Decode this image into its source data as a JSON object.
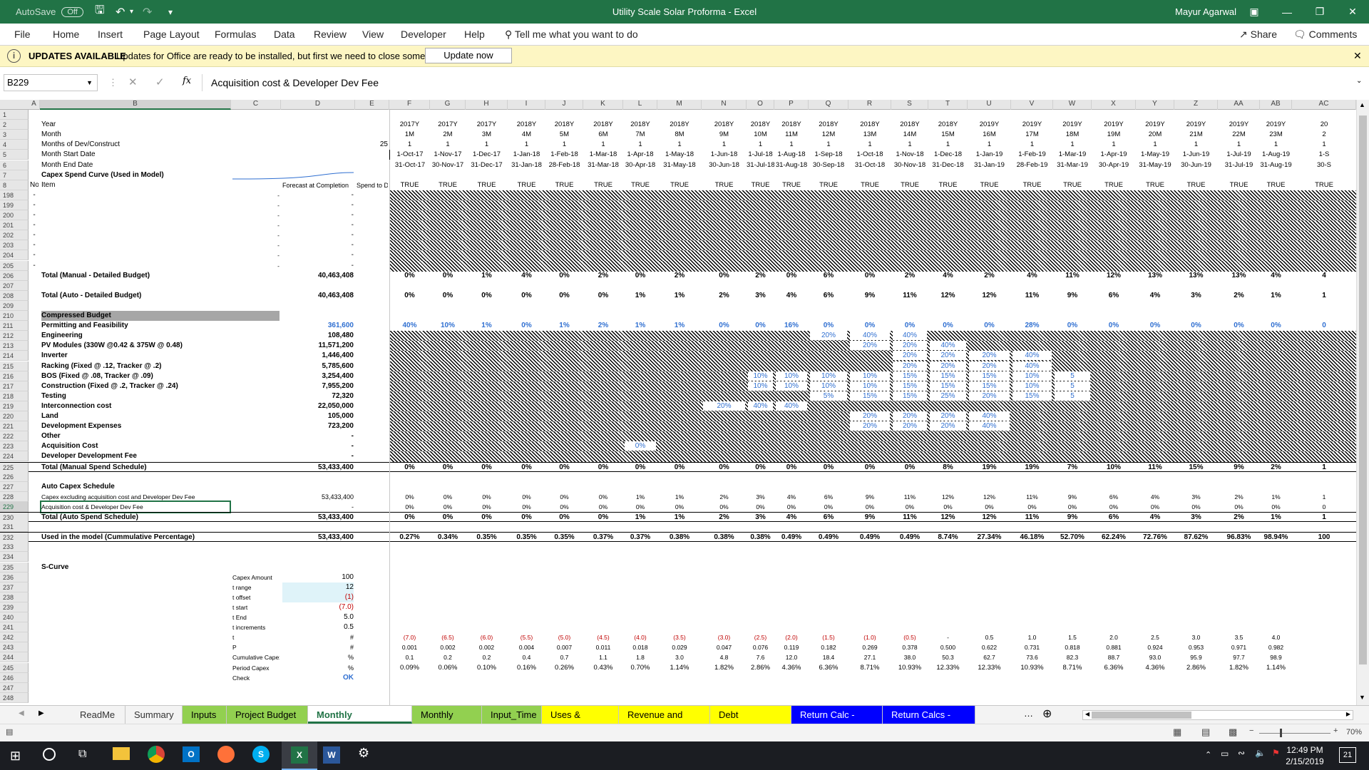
{
  "title": "Utility Scale Solar Proforma  -  Excel",
  "autosave_label": "AutoSave",
  "autosave_state": "Off",
  "user": "Mayur Agarwal",
  "ribbon_tabs": [
    "File",
    "Home",
    "Insert",
    "Page Layout",
    "Formulas",
    "Data",
    "Review",
    "View",
    "Developer",
    "Help"
  ],
  "tell_me": "Tell me what you want to do",
  "share": "Share",
  "comments": "Comments",
  "update_title": "UPDATES AVAILABLE",
  "update_msg": "Updates for Office are ready to be installed, but first we need to close some apps.",
  "update_btn": "Update now",
  "namebox": "B229",
  "formula": "Acquisition cost & Developer Dev Fee",
  "col_headers": [
    "A",
    "B",
    "C",
    "D",
    "E",
    "F",
    "G",
    "H",
    "I",
    "J",
    "K",
    "L",
    "M",
    "N",
    "O",
    "P",
    "Q",
    "R",
    "S",
    "T",
    "U",
    "V",
    "W",
    "X",
    "Y",
    "Z",
    "AA",
    "AB",
    "AC"
  ],
  "years": [
    "2017Y",
    "2017Y",
    "2017Y",
    "2018Y",
    "2018Y",
    "2018Y",
    "2018Y",
    "2018Y",
    "2018Y",
    "2018Y",
    "2018Y",
    "2018Y",
    "2018Y",
    "2018Y",
    "2018Y",
    "2019Y",
    "2019Y",
    "2019Y",
    "2019Y",
    "2019Y",
    "2019Y",
    "2019Y",
    "2019Y",
    "20"
  ],
  "months": [
    "1M",
    "2M",
    "3M",
    "4M",
    "5M",
    "6M",
    "7M",
    "8M",
    "9M",
    "10M",
    "11M",
    "12M",
    "13M",
    "14M",
    "15M",
    "16M",
    "17M",
    "18M",
    "19M",
    "20M",
    "21M",
    "22M",
    "23M",
    "2"
  ],
  "starts": [
    "1-Oct-17",
    "1-Nov-17",
    "1-Dec-17",
    "1-Jan-18",
    "1-Feb-18",
    "1-Mar-18",
    "1-Apr-18",
    "1-May-18",
    "1-Jun-18",
    "1-Jul-18",
    "1-Aug-18",
    "1-Sep-18",
    "1-Oct-18",
    "1-Nov-18",
    "1-Dec-18",
    "1-Jan-19",
    "1-Feb-19",
    "1-Mar-19",
    "1-Apr-19",
    "1-May-19",
    "1-Jun-19",
    "1-Jul-19",
    "1-Aug-19",
    "1-S"
  ],
  "ends": [
    "31-Oct-17",
    "30-Nov-17",
    "31-Dec-17",
    "31-Jan-18",
    "28-Feb-18",
    "31-Mar-18",
    "30-Apr-18",
    "31-May-18",
    "30-Jun-18",
    "31-Jul-18",
    "31-Aug-18",
    "30-Sep-18",
    "31-Oct-18",
    "30-Nov-18",
    "31-Dec-18",
    "31-Jan-19",
    "28-Feb-19",
    "31-Mar-19",
    "30-Apr-19",
    "31-May-19",
    "30-Jun-19",
    "31-Jul-19",
    "31-Aug-19",
    "30-S"
  ],
  "rows": [
    {
      "n": "1"
    },
    {
      "n": "2",
      "b": "Year",
      "timeline": "years"
    },
    {
      "n": "3",
      "b": "Month",
      "timeline": "months"
    },
    {
      "n": "4",
      "b": "Months of Dev/Construct",
      "e": "25",
      "timeline": "ones"
    },
    {
      "n": "5",
      "b": "Month Start Date",
      "timeline": "starts"
    },
    {
      "n": "6",
      "b": "Month End Date",
      "timeline": "ends"
    },
    {
      "n": "7",
      "b": "Capex Spend Curve (Used in Model)",
      "bold": true
    },
    {
      "n": "8",
      "a": "No.",
      "b": "Item",
      "d": "Forecast at Completion",
      "e": "Spend to Date",
      "timeline": "trues"
    },
    {
      "n": "198",
      "a": "-",
      "c": "-",
      "d": "-",
      "hatch": true
    },
    {
      "n": "199",
      "a": "-",
      "c": "-",
      "d": "-",
      "hatch": true
    },
    {
      "n": "200",
      "a": "-",
      "c": "-",
      "d": "-",
      "hatch": true
    },
    {
      "n": "201",
      "a": "-",
      "c": "-",
      "d": "-",
      "hatch": true
    },
    {
      "n": "202",
      "a": "-",
      "c": "-",
      "d": "-",
      "hatch": true
    },
    {
      "n": "203",
      "a": "-",
      "c": "-",
      "d": "-",
      "hatch": true
    },
    {
      "n": "204",
      "a": "-",
      "c": "-",
      "d": "-",
      "hatch": true
    },
    {
      "n": "205",
      "a": "-",
      "c": "-",
      "d": "-",
      "hatch": true
    },
    {
      "n": "206",
      "b": "Total (Manual - Detailed Budget)",
      "d": "40,463,408",
      "bold": true,
      "vals": [
        "0%",
        "0%",
        "1%",
        "4%",
        "0%",
        "2%",
        "0%",
        "2%",
        "0%",
        "2%",
        "0%",
        "6%",
        "0%",
        "2%",
        "4%",
        "2%",
        "4%",
        "11%",
        "12%",
        "13%",
        "13%",
        "13%",
        "4%",
        "4"
      ]
    },
    {
      "n": "207"
    },
    {
      "n": "208",
      "b": "Total (Auto - Detailed Budget)",
      "d": "40,463,408",
      "bold": true,
      "vals": [
        "0%",
        "0%",
        "0%",
        "0%",
        "0%",
        "0%",
        "1%",
        "1%",
        "2%",
        "3%",
        "4%",
        "6%",
        "9%",
        "11%",
        "12%",
        "12%",
        "11%",
        "9%",
        "6%",
        "4%",
        "3%",
        "2%",
        "1%",
        "1"
      ]
    },
    {
      "n": "209"
    },
    {
      "n": "210",
      "b": "Compressed Budget",
      "bold": true,
      "grey": true
    },
    {
      "n": "211",
      "b": "Permitting and Feasibility",
      "d": "361,600",
      "bold": true,
      "blue": true,
      "vals": [
        "40%",
        "10%",
        "1%",
        "0%",
        "1%",
        "2%",
        "1%",
        "1%",
        "0%",
        "0%",
        "16%",
        "0%",
        "0%",
        "0%",
        "0%",
        "0%",
        "28%",
        "0%",
        "0%",
        "0%",
        "0%",
        "0%",
        "0%",
        "0"
      ]
    },
    {
      "n": "212",
      "b": "Engineering",
      "d": "108,480",
      "bold": true,
      "hatch": true
    },
    {
      "n": "213",
      "b": "PV Modules (330W @0.42 & 375W @ 0.48)",
      "d": "11,571,200",
      "bold": true,
      "hatch": true
    },
    {
      "n": "214",
      "b": "Inverter",
      "d": "1,446,400",
      "bold": true,
      "hatch": true
    },
    {
      "n": "215",
      "b": "Racking (Fixed @ .12, Tracker @ .2)",
      "d": "5,785,600",
      "bold": true,
      "hatch": true
    },
    {
      "n": "216",
      "b": "BOS (Fixed @ .08, Tracker @ .09)",
      "d": "3,254,400",
      "bold": true,
      "hatch": true
    },
    {
      "n": "217",
      "b": "Construction (Fixed @ .2, Tracker @ .24)",
      "d": "7,955,200",
      "bold": true,
      "hatch": true
    },
    {
      "n": "218",
      "b": "Testing",
      "d": "72,320",
      "bold": true,
      "hatch": true
    },
    {
      "n": "219",
      "b": "Interconnection cost",
      "d": "22,050,000",
      "bold": true,
      "hatch": true
    },
    {
      "n": "220",
      "b": "Land",
      "d": "105,000",
      "bold": true,
      "hatch": true
    },
    {
      "n": "221",
      "b": "Development Expenses",
      "d": "723,200",
      "bold": true,
      "hatch": true
    },
    {
      "n": "222",
      "b": "Other",
      "d": "-",
      "bold": true,
      "hatch": true
    },
    {
      "n": "223",
      "b": "Acquisition Cost",
      "d": "-",
      "bold": true,
      "hatch": true
    },
    {
      "n": "224",
      "b": "Developer  Development Fee",
      "d": "-",
      "bold": true,
      "hatch": true
    },
    {
      "n": "225",
      "b": "Total (Manual Spend Schedule)",
      "d": "53,433,400",
      "bold": true,
      "boxed": true,
      "vals": [
        "0%",
        "0%",
        "0%",
        "0%",
        "0%",
        "0%",
        "0%",
        "0%",
        "0%",
        "0%",
        "0%",
        "0%",
        "0%",
        "0%",
        "8%",
        "19%",
        "19%",
        "7%",
        "10%",
        "11%",
        "15%",
        "9%",
        "2%",
        "1"
      ]
    },
    {
      "n": "226"
    },
    {
      "n": "227",
      "b": "Auto Capex Schedule",
      "bold": true
    },
    {
      "n": "228",
      "b": "Capex excluding acquisition cost and Developer Dev Fee",
      "d": "53,433,400",
      "small": true,
      "vals": [
        "0%",
        "0%",
        "0%",
        "0%",
        "0%",
        "0%",
        "1%",
        "1%",
        "2%",
        "3%",
        "4%",
        "6%",
        "9%",
        "11%",
        "12%",
        "12%",
        "11%",
        "9%",
        "6%",
        "4%",
        "3%",
        "2%",
        "1%",
        "1"
      ]
    },
    {
      "n": "229",
      "b": "Acquisition cost & Developer Dev Fee",
      "d": "-",
      "small": true,
      "selected": true,
      "vals": [
        "0%",
        "0%",
        "0%",
        "0%",
        "0%",
        "0%",
        "0%",
        "0%",
        "0%",
        "0%",
        "0%",
        "0%",
        "0%",
        "0%",
        "0%",
        "0%",
        "0%",
        "0%",
        "0%",
        "0%",
        "0%",
        "0%",
        "0%",
        "0"
      ]
    },
    {
      "n": "230",
      "b": "Total (Auto Spend Schedule)",
      "d": "53,433,400",
      "bold": true,
      "boxed": true,
      "vals": [
        "0%",
        "0%",
        "0%",
        "0%",
        "0%",
        "0%",
        "1%",
        "1%",
        "2%",
        "3%",
        "4%",
        "6%",
        "9%",
        "11%",
        "12%",
        "12%",
        "11%",
        "9%",
        "6%",
        "4%",
        "3%",
        "2%",
        "1%",
        "1"
      ]
    },
    {
      "n": "231"
    },
    {
      "n": "232",
      "b": "Used in the model (Cummulative Percentage)",
      "d": "53,433,400",
      "bold": true,
      "boxed": true,
      "vals": [
        "0.27%",
        "0.34%",
        "0.35%",
        "0.35%",
        "0.35%",
        "0.37%",
        "0.37%",
        "0.38%",
        "0.38%",
        "0.38%",
        "0.49%",
        "0.49%",
        "0.49%",
        "0.49%",
        "8.74%",
        "27.34%",
        "46.18%",
        "52.70%",
        "62.24%",
        "72.76%",
        "87.62%",
        "96.83%",
        "98.94%",
        "100"
      ]
    },
    {
      "n": "233"
    },
    {
      "n": "234"
    },
    {
      "n": "235",
      "b": "S-Curve",
      "bold": true
    },
    {
      "n": "236",
      "c": "Capex Amount",
      "d": "100"
    },
    {
      "n": "237",
      "c": "t range",
      "d": "12",
      "cyan": true
    },
    {
      "n": "238",
      "c": "t offset",
      "d": "(1)",
      "cyan": true,
      "red": true
    },
    {
      "n": "239",
      "c": "t start",
      "d": "(7.0)",
      "red": true
    },
    {
      "n": "240",
      "c": "t End",
      "d": "5.0"
    },
    {
      "n": "241",
      "c": "t increments",
      "d": "0.5"
    },
    {
      "n": "242",
      "c": "t",
      "d": "#",
      "vals": [
        "(7.0)",
        "(6.5)",
        "(6.0)",
        "(5.5)",
        "(5.0)",
        "(4.5)",
        "(4.0)",
        "(3.5)",
        "(3.0)",
        "(2.5)",
        "(2.0)",
        "(1.5)",
        "(1.0)",
        "(0.5)",
        "-",
        "0.5",
        "1.0",
        "1.5",
        "2.0",
        "2.5",
        "3.0",
        "3.5",
        "4.0",
        ""
      ],
      "small": true
    },
    {
      "n": "243",
      "c": "P",
      "d": "#",
      "vals": [
        "0.001",
        "0.002",
        "0.002",
        "0.004",
        "0.007",
        "0.011",
        "0.018",
        "0.029",
        "0.047",
        "0.076",
        "0.119",
        "0.182",
        "0.269",
        "0.378",
        "0.500",
        "0.622",
        "0.731",
        "0.818",
        "0.881",
        "0.924",
        "0.953",
        "0.971",
        "0.982",
        ""
      ],
      "small": true
    },
    {
      "n": "244",
      "c": "Cumulative Capex",
      "d": "%",
      "vals": [
        "0.1",
        "0.2",
        "0.2",
        "0.4",
        "0.7",
        "1.1",
        "1.8",
        "3.0",
        "4.8",
        "7.6",
        "12.0",
        "18.4",
        "27.1",
        "38.0",
        "50.3",
        "62.7",
        "73.6",
        "82.3",
        "88.7",
        "93.0",
        "95.9",
        "97.7",
        "98.9",
        ""
      ],
      "small": true
    },
    {
      "n": "245",
      "c": "Period Capex",
      "d": "%",
      "vals": [
        "0.09%",
        "0.06%",
        "0.10%",
        "0.16%",
        "0.26%",
        "0.43%",
        "0.70%",
        "1.14%",
        "1.82%",
        "2.86%",
        "4.36%",
        "6.36%",
        "8.71%",
        "10.93%",
        "12.33%",
        "12.33%",
        "10.93%",
        "8.71%",
        "6.36%",
        "4.36%",
        "2.86%",
        "1.82%",
        "1.14%",
        ""
      ],
      "small": true
    },
    {
      "n": "246",
      "c": "Check",
      "d": "OK",
      "blue": true
    },
    {
      "n": "247"
    },
    {
      "n": "248"
    }
  ],
  "sheet_tabs": [
    {
      "label": "ReadMe",
      "color": "#f3f3f3",
      "fg": "#333"
    },
    {
      "label": "Summary",
      "color": "#f3f3f3",
      "fg": "#333"
    },
    {
      "label": "Inputs",
      "color": "#92d050",
      "fg": "#000"
    },
    {
      "label": "Project Budget",
      "color": "#92d050",
      "fg": "#000"
    },
    {
      "label": "Monthly Percentage",
      "color": "#ffffff",
      "fg": "#217346"
    },
    {
      "label": "Monthly Cost",
      "color": "#92d050",
      "fg": "#000"
    },
    {
      "label": "Input_Time",
      "color": "#92d050",
      "fg": "#000"
    },
    {
      "label": "Uses & Sources",
      "color": "#ffff00",
      "fg": "#000"
    },
    {
      "label": "Revenue and Costs",
      "color": "#ffff00",
      "fg": "#000"
    },
    {
      "label": "Debt Repayment",
      "color": "#ffff00",
      "fg": "#000"
    },
    {
      "label": "Return Calc - PFLIP",
      "color": "#0000ff",
      "fg": "#fff"
    },
    {
      "label": "Return Calcs - Inve",
      "color": "#0000ff",
      "fg": "#fff"
    }
  ],
  "zoom": "70%",
  "clock_time": "12:49 PM",
  "clock_date": "2/15/2019",
  "notif": "21",
  "colors": {
    "excel_green": "#217346",
    "hatch": "#000000",
    "blue": "#2f6fd1",
    "red": "#c00000"
  }
}
